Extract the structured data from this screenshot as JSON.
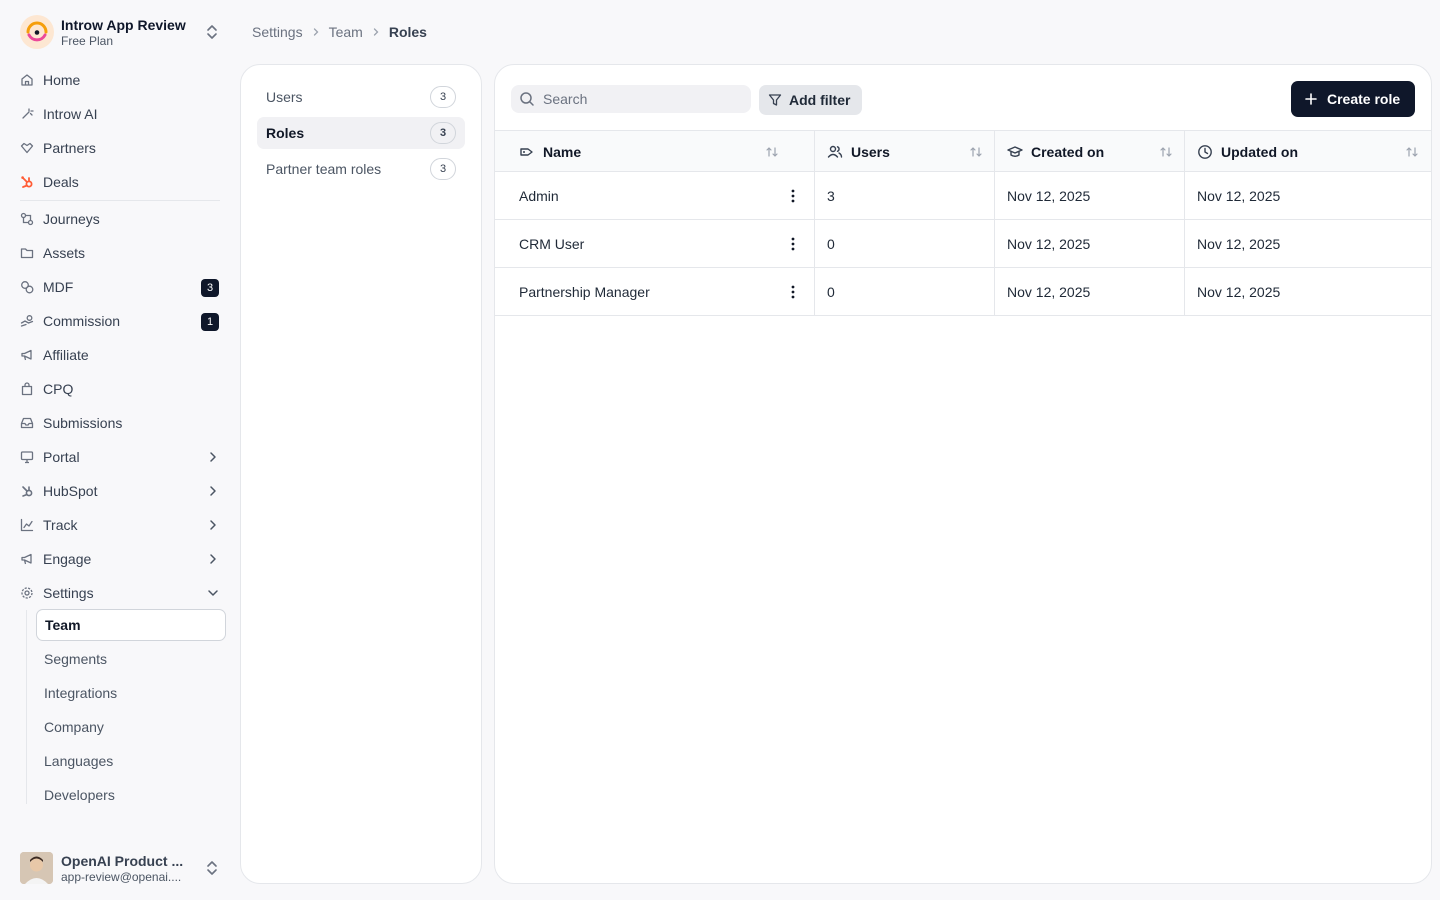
{
  "workspace": {
    "name": "Introw App Review",
    "plan": "Free Plan"
  },
  "nav": {
    "home": "Home",
    "introw_ai": "Introw AI",
    "partners": "Partners",
    "deals": "Deals",
    "journeys": "Journeys",
    "assets": "Assets",
    "mdf": "MDF",
    "mdf_badge": "3",
    "commission": "Commission",
    "commission_badge": "1",
    "affiliate": "Affiliate",
    "cpq": "CPQ",
    "submissions": "Submissions",
    "portal": "Portal",
    "hubspot": "HubSpot",
    "track": "Track",
    "engage": "Engage",
    "settings": "Settings",
    "settings_sub": [
      "Team",
      "Segments",
      "Integrations",
      "Company",
      "Languages",
      "Developers"
    ]
  },
  "user": {
    "name": "OpenAI Product ...",
    "email": "app-review@openai...."
  },
  "breadcrumb": [
    "Settings",
    "Team",
    "Roles"
  ],
  "subtabs": [
    {
      "label": "Users",
      "count": "3"
    },
    {
      "label": "Roles",
      "count": "3"
    },
    {
      "label": "Partner team roles",
      "count": "3"
    }
  ],
  "toolbar": {
    "search_placeholder": "Search",
    "add_filter": "Add filter",
    "create_role": "Create role"
  },
  "table": {
    "columns": [
      "Name",
      "Users",
      "Created on",
      "Updated on"
    ],
    "rows": [
      {
        "name": "Admin",
        "users": "3",
        "created": "Nov 12, 2025",
        "updated": "Nov 12, 2025"
      },
      {
        "name": "CRM User",
        "users": "0",
        "created": "Nov 12, 2025",
        "updated": "Nov 12, 2025"
      },
      {
        "name": "Partnership Manager",
        "users": "0",
        "created": "Nov 12, 2025",
        "updated": "Nov 12, 2025"
      }
    ]
  },
  "colors": {
    "primary": "#0f172a",
    "hubspot_orange": "#ff5c35",
    "logo_pink": "#ec4899"
  }
}
